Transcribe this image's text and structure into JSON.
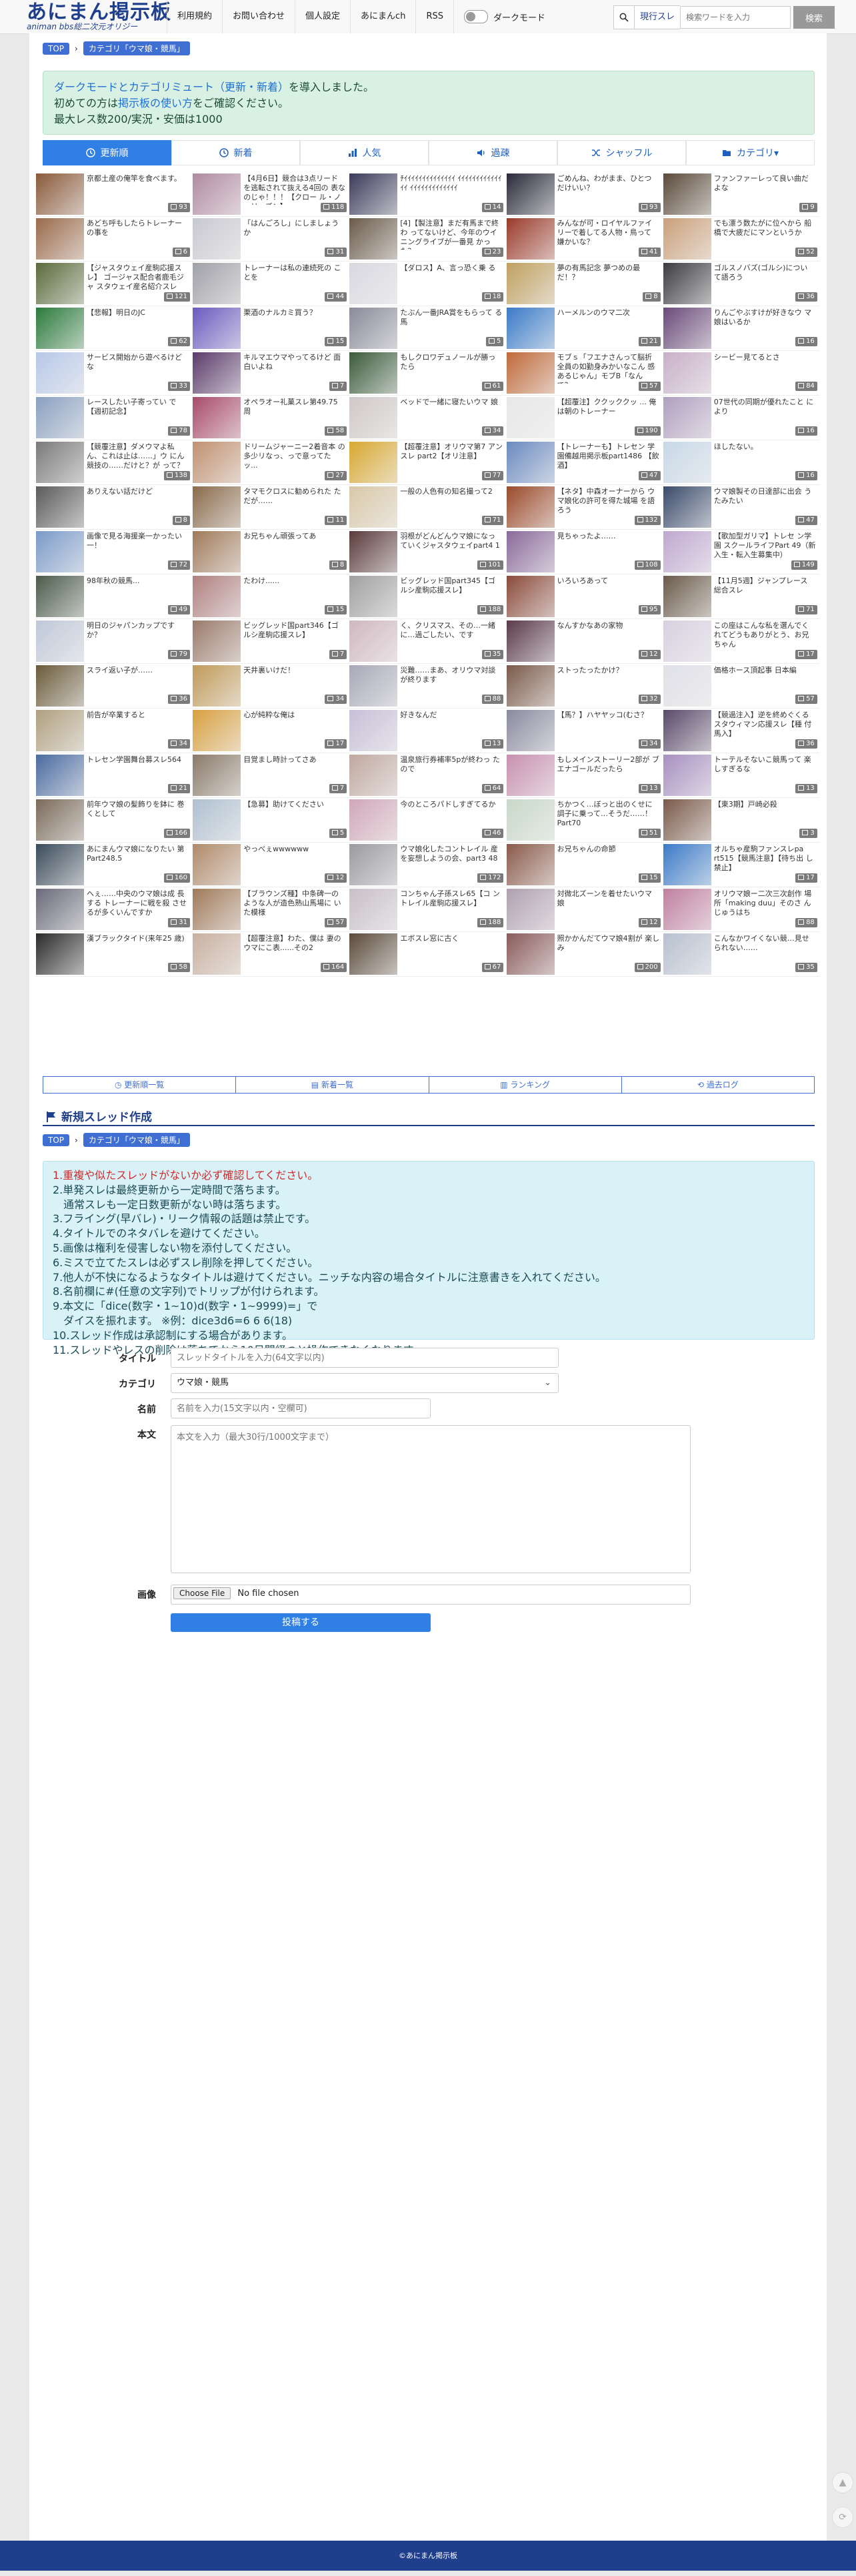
{
  "header": {
    "logo_title": "あにまん掲示板",
    "logo_sub": "animan bbs総二次元オリジー",
    "nav": [
      "利用規約",
      "お問い合わせ",
      "個人設定",
      "あにまんch",
      "RSS"
    ],
    "dark_mode_label": "ダークモード",
    "search_scope": "現行スレ",
    "search_placeholder": "検索ワードを入力",
    "search_button": "検索"
  },
  "breadcrumb": {
    "top": "TOP",
    "category": "カテゴリ「ウマ娘・競馬」"
  },
  "notice": {
    "line1_pre": "ダークモードとカテゴリミュート（更新・新着）",
    "line1_post": "を導入しました。",
    "line2_pre": "初めての方は",
    "line2_link": "掲示板の使い方",
    "line2_post": "をご確認ください。",
    "line3": "最大レス数200/実況・安価は1000"
  },
  "tabs": [
    "更新順",
    "新着",
    "人気",
    "過疎",
    "シャッフル",
    "カテゴリ▾"
  ],
  "threads": [
    {
      "title": "京都土産の俺竿を食べます。",
      "count": "93",
      "color": "#8a5a3a"
    },
    {
      "title": "【4月6日】競合は3点リード を逃転されて抜える4回の 表なのじゃ！！！【クロー ル・ノーリーズン】",
      "count": "118",
      "color": "#b08aa0"
    },
    {
      "title": "ﾁｲｲｲｲｲｲｲｲｲｲｲｲｲｲ ｲｲｲｲｲｲｲｲｲｲｲｲｲｲ ｲｲｲｲｲｲｲｲｲｲｲｲｲ",
      "count": "14",
      "color": "#3a3a5a"
    },
    {
      "title": "ごめんね、わがまま、ひとつ だけいい？",
      "count": "93",
      "color": "#2a2a3a"
    },
    {
      "title": "ファンファーレって良い曲だ よな",
      "count": "9",
      "color": "#5a4a3a"
    },
    {
      "title": "あどち呼もしたらトレーナー の事を",
      "count": "6",
      "color": "#9a6a4a"
    },
    {
      "title": "「はんごろし」にしましょう か",
      "count": "31",
      "color": "#c8c8d0"
    },
    {
      "title": "[4]【製注意】まだ有馬まで終わ ってないけど、今年のウイ ニングライブが一番見 かった？",
      "count": "23",
      "color": "#6a5a4a"
    },
    {
      "title": "みんなが可・ロイヤルファイ リーで着してる人物・鳥って 嫌かいな？",
      "count": "41",
      "color": "#9a3a2a"
    },
    {
      "title": "でも漂う数たがに位へから 船橋で大疲だにマンというか",
      "count": "52",
      "color": "#caa07a"
    },
    {
      "title": "【ジャスタウェイ産駒応援スレ】 ゴージャス配合者鹿毛ジャ スタウェイ産名紹介スレ",
      "count": "121",
      "color": "#5a6a3a"
    },
    {
      "title": "トレーナーは私の連続死の ことを",
      "count": "44",
      "color": "#a0a0a8"
    },
    {
      "title": "【ダロス】A、言っ恐く乗 る",
      "count": "18",
      "color": "#d8d8e0"
    },
    {
      "title": "夢の有馬記念 夢つめの最 だ！？",
      "count": "8",
      "color": "#c0a060"
    },
    {
      "title": "ゴルスノバズ(ゴルシ)につい て語ろう",
      "count": "36",
      "color": "#3a3a40"
    },
    {
      "title": "【悲報】明日のJC",
      "count": "62",
      "color": "#2a7a3a"
    },
    {
      "title": "栗酒のナルカミ買う？",
      "count": "15",
      "color": "#6a5ac0"
    },
    {
      "title": "たぶん一番JRA賞をもらって る馬",
      "count": "5",
      "color": "#8a8a9a"
    },
    {
      "title": "ハーメルンのウマ二次",
      "count": "21",
      "color": "#3a7ac8"
    },
    {
      "title": "りんごやぶすけが好きなウ マ娘はいるか",
      "count": "16",
      "color": "#6a4a7a"
    },
    {
      "title": "サービス開始から遊べるけど な",
      "count": "33",
      "color": "#b8c8e8"
    },
    {
      "title": "キルマエウマやってるけど 面白いよね",
      "count": "7",
      "color": "#5a3a6a"
    },
    {
      "title": "もしクロワデュノールが勝っ たら",
      "count": "61",
      "color": "#3a5a3a"
    },
    {
      "title": "モブｓ「フエナさんって脳折 全員の如勤身みかいなこん 感あるじゃん」モブB「なん で？」",
      "count": "57",
      "color": "#c06a3a"
    },
    {
      "title": "シービー見てるとさ",
      "count": "84",
      "color": "#c8b0c8"
    },
    {
      "title": "レースしたい子寄ってい で【週初記念】",
      "count": "78",
      "color": "#8aa0c0"
    },
    {
      "title": "オペラオー礼菓スレ第49.75 周",
      "count": "58",
      "color": "#a84a6a"
    },
    {
      "title": "ベッドで一緒に寝たいウマ 娘",
      "count": "34",
      "color": "#d0c8c8"
    },
    {
      "title": "【超覆注】ククッククッ ... 俺は朝のトレーナー",
      "count": "190",
      "color": "#e8e8e8"
    },
    {
      "title": "07世代の同期が優れたこと により",
      "count": "16",
      "color": "#b0a0c0"
    },
    {
      "title": "【競覆注意】ダメウマよ私 ん、これは止は……」ウ にん競技の……だけと？が って？",
      "count": "138",
      "color": "#7a7a7a"
    },
    {
      "title": "ドリームジャーニー2着音本 の多少リなっ、っで意ってた ッ...",
      "count": "27",
      "color": "#c09070"
    },
    {
      "title": "【超覆注意】オリウマ第7 アンスレ part2【オリ注意】",
      "count": "77",
      "color": "#d8a830"
    },
    {
      "title": "【トレーナーも】トレセン 学園備越用掲示板part1486 【飲酒】",
      "count": "47",
      "color": "#6a8ac0"
    },
    {
      "title": "ほしたない。",
      "count": "16",
      "color": "#c8d8e8"
    },
    {
      "title": "ありえない話だけど",
      "count": "8",
      "color": "#5a5a5a"
    },
    {
      "title": "タマモクロスに勧められた ただが……",
      "count": "11",
      "color": "#8a6a4a"
    },
    {
      "title": "一般の人色有の知名撮って2",
      "count": "71",
      "color": "#d8c8a8"
    },
    {
      "title": "【ネタ】中森オーナーから ウマ娘化の許可を得た城場 を語ろう",
      "count": "132",
      "color": "#9a4a2a"
    },
    {
      "title": "ウマ娘製その日達部に出会 うたみたい",
      "count": "47",
      "color": "#3a4a6a"
    },
    {
      "title": "画像で見る海援楽一かったい 一！",
      "count": "72",
      "color": "#7a9ac8"
    },
    {
      "title": "お兄ちゃん頑張ってあ",
      "count": "8",
      "color": "#a07a5a"
    },
    {
      "title": "羽根がどんどんウマ娘になっ ていくジャスタウェイpart4 1",
      "count": "101",
      "color": "#5a3a3a"
    },
    {
      "title": "見ちゃったよ……",
      "count": "108",
      "color": "#8a6a9a"
    },
    {
      "title": "【歌加型ガリマ】トレセ ン学園 スクールライフPart 49（新入生・転入生募集中）",
      "count": "149",
      "color": "#c0a8d0"
    },
    {
      "title": "98年秋の競馬...",
      "count": "49",
      "color": "#4a5a4a"
    },
    {
      "title": "たわけ......",
      "count": "15",
      "color": "#b08080"
    },
    {
      "title": "ビッグレッド国part345【ゴ ルシ産駒応援スレ】",
      "count": "188",
      "color": "#a0a0a0"
    },
    {
      "title": "いろいろあって",
      "count": "95",
      "color": "#8a4a3a"
    },
    {
      "title": "【11月5週】ジャンプレース 総合スレ",
      "count": "71",
      "color": "#6a5a4a"
    },
    {
      "title": "明日のジャパンカップです か？",
      "count": "79",
      "color": "#c0c8d8"
    },
    {
      "title": "ビッグレッド国part346【ゴ ルシ産駒応援スレ】",
      "count": "7",
      "color": "#9a7a6a"
    },
    {
      "title": "く、クリスマス、その…一緒 に…過ごしたい、です",
      "count": "35",
      "color": "#d0b8c0"
    },
    {
      "title": "なんすかなあの家物",
      "count": "12",
      "color": "#5a3a4a"
    },
    {
      "title": "この座はこんな私を選んでく れてどうもありがとう、お兄 ちゃん",
      "count": "17",
      "color": "#d8d0e0"
    },
    {
      "title": "スライ返い子が……",
      "count": "36",
      "color": "#6a5a3a"
    },
    {
      "title": "天井裏いけだ！",
      "count": "34",
      "color": "#c09a5a"
    },
    {
      "title": "災難……まあ、オリウマ対談 が終ります",
      "count": "88",
      "color": "#a8a8b8"
    },
    {
      "title": "ストったったかけ？",
      "count": "32",
      "color": "#7a5a4a"
    },
    {
      "title": "価格ホース頂起事 日本編",
      "count": "57",
      "color": "#e0e0e8"
    },
    {
      "title": "前告が卒業すると",
      "count": "34",
      "color": "#b0a080"
    },
    {
      "title": "心が純粋な俺は",
      "count": "17",
      "color": "#d8a040"
    },
    {
      "title": "好きなんだ",
      "count": "13",
      "color": "#c8c0d8"
    },
    {
      "title": "【馬？】ハヤヤッコ(むさ？",
      "count": "34",
      "color": "#8a8aa0"
    },
    {
      "title": "【競過注入】逆を終めぐくる スタウィマン応援スレ【種 付馬入】",
      "count": "36",
      "color": "#5a4a6a"
    },
    {
      "title": "トレセン学園舞台募スレ564",
      "count": "21",
      "color": "#4a6aa0"
    },
    {
      "title": "目覚まし時計ってさあ",
      "count": "7",
      "color": "#8a7a6a"
    },
    {
      "title": "温泉旅行券補率5pが終わっ たので",
      "count": "64",
      "color": "#c0a8a0"
    },
    {
      "title": "もしメインストーリー2部が ブエナゴールだったら",
      "count": "13",
      "color": "#c890b0"
    },
    {
      "title": "トーテルそないこ競馬って 楽しすぎるな",
      "count": "13",
      "color": "#a890c0"
    },
    {
      "title": "前年ウマ娘の髪飾りを鉢に 巻くとして",
      "count": "166",
      "color": "#7a6a5a"
    },
    {
      "title": "【急募】助けてください",
      "count": "5",
      "color": "#b0c0d0"
    },
    {
      "title": "今のところパドしすぎてるか",
      "count": "46",
      "color": "#d0a8b8"
    },
    {
      "title": "ちかつく…ぼっと出のくせに 調子に乗って…そうだ……！ Part70",
      "count": "51",
      "color": "#c8d8c8"
    },
    {
      "title": "【東3期】戸崎必殺",
      "count": "3",
      "color": "#7a5a4a"
    },
    {
      "title": "あにまんウマ娘になりたい 第Part248.5",
      "count": "160",
      "color": "#3a4a5a"
    },
    {
      "title": "やっべぇwwwwww",
      "count": "12",
      "color": "#b08a6a"
    },
    {
      "title": "ウマ娘化したコントレイル 産を妄想しようの会、part3 48",
      "count": "172",
      "color": "#9a9aa0"
    },
    {
      "title": "お兄ちゃんの命節",
      "count": "15",
      "color": "#8a5a4a"
    },
    {
      "title": "オルちゃ産駒ファンスレpa rt515【競馬注意】【待ち出 し禁止】",
      "count": "17",
      "color": "#3a7ac8"
    },
    {
      "title": "へぇ……中央のウマ娘は成 長する トレーナーに戦を殺 させるが多くいんですか",
      "count": "31",
      "color": "#6a6a7a"
    },
    {
      "title": "【ブラウンズ種】中条碑一の ような人が造色熟山馬場に いた模様",
      "count": "57",
      "color": "#a07a5a"
    },
    {
      "title": "コンちゃん子孫スレ65【コ ントレイル産駒応援スレ】",
      "count": "188",
      "color": "#c8c0c8"
    },
    {
      "title": "対微北ズーンを着せたいウマ 娘",
      "count": "12",
      "color": "#b0a0b0"
    },
    {
      "title": "オリウマ娘ー二次三次創作 場所「making duu」そのさ んじゅうはち",
      "count": "88",
      "color": "#c080a0"
    },
    {
      "title": "漢ブラックタイド(来年25 歳)",
      "count": "58",
      "color": "#2a2a2a"
    },
    {
      "title": "【超覆注意】わた、僕は 妻のウマにこ表......その2",
      "count": "164",
      "color": "#c8b0a0"
    },
    {
      "title": "エボスレ窓に古く",
      "count": "67",
      "color": "#5a4a3a"
    },
    {
      "title": "照かかんだてウマ娘4割が 楽しみ",
      "count": "200",
      "color": "#8a5a5a"
    },
    {
      "title": "こんなかワイくない競…見せ られない……",
      "count": "35",
      "color": "#b8c0d0"
    }
  ],
  "bottom_tabs": [
    "更新順一覧",
    "新着一覧",
    "ランキング",
    "過去ログ"
  ],
  "create_title": "新規スレッド作成",
  "rules": [
    "1.重複や似たスレッドがないか必ず確認してください。",
    "2.単発スレは最終更新から一定時間で落ちます。",
    "　通常スレも一定日数更新がない時は落ちます。",
    "3.フライング(早バレ)・リーク情報の話題は禁止です。",
    "4.タイトルでのネタバレを避けてください。",
    "5.画像は権利を侵害しない物を添付してください。",
    "6.ミスで立てたスレは必ずスレ削除を押してください。",
    "7.他人が不快になるようなタイトルは避けてください。ニッチな内容の場合タイトルに注意書きを入れてください。",
    "8.名前欄に#(任意の文字列)でトリップが付けられます。",
    "9.本文に「dice(数字・1~10)d(数字・1~9999)=」で",
    "　ダイスを振れます。 ※例：dice3d6=6 6 6(18)",
    "10.スレッド作成は承認制にする場合があります。",
    "11.スレッドやレスの削除は落ちてから10日間経つと操作できなくなります。"
  ],
  "form": {
    "title_label": "タイトル",
    "title_placeholder": "スレッドタイトルを入力(64文字以内)",
    "category_label": "カテゴリ",
    "category_value": "ウマ娘・競馬",
    "name_label": "名前",
    "name_placeholder": "名前を入力(15文字以内・空欄可)",
    "body_label": "本文",
    "body_placeholder": "本文を入力（最大30行/1000文字まで）",
    "image_label": "画像",
    "file_button": "Choose File",
    "file_status": "No file chosen",
    "submit": "投稿する"
  },
  "footer": "©あにまん掲示板"
}
